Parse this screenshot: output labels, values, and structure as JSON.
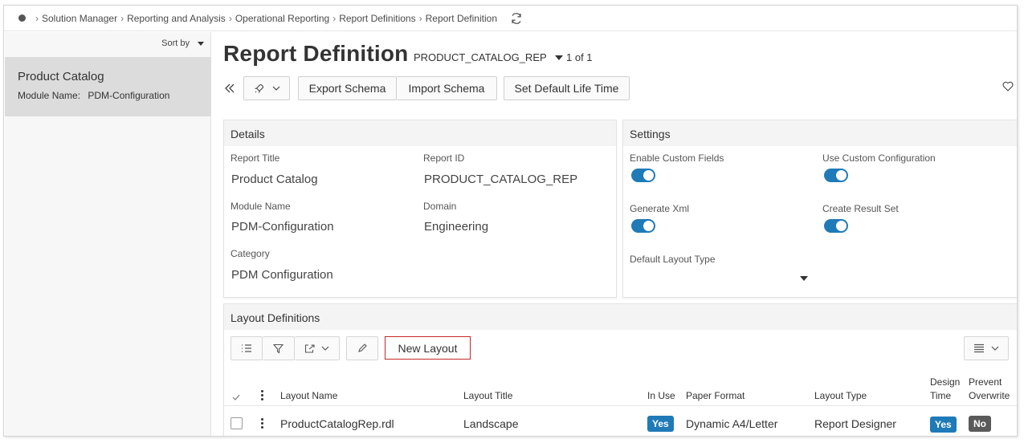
{
  "breadcrumb": {
    "items": [
      "Solution Manager",
      "Reporting and Analysis",
      "Operational Reporting",
      "Report Definitions",
      "Report Definition"
    ]
  },
  "list": {
    "sort_label": "Sort by",
    "selected": {
      "title": "Product Catalog",
      "meta_label": "Module Name:",
      "meta_value": "PDM-Configuration"
    }
  },
  "header": {
    "title": "Report Definition",
    "record_id": "PRODUCT_CATALOG_REP",
    "record_count": "1 of 1"
  },
  "toolbar": {
    "export_schema": "Export Schema",
    "import_schema": "Import Schema",
    "set_default_life_time": "Set Default Life Time"
  },
  "details": {
    "heading": "Details",
    "report_title_label": "Report Title",
    "report_title_value": "Product Catalog",
    "report_id_label": "Report ID",
    "report_id_value": "PRODUCT_CATALOG_REP",
    "module_name_label": "Module Name",
    "module_name_value": "PDM-Configuration",
    "domain_label": "Domain",
    "domain_value": "Engineering",
    "category_label": "Category",
    "category_value": "PDM Configuration"
  },
  "settings": {
    "heading": "Settings",
    "enable_custom_fields_label": "Enable Custom Fields",
    "enable_custom_fields": true,
    "use_custom_configuration_label": "Use Custom Configuration",
    "use_custom_configuration": true,
    "generate_xml_label": "Generate Xml",
    "generate_xml": true,
    "create_result_set_label": "Create Result Set",
    "create_result_set": true,
    "default_layout_type_label": "Default Layout Type",
    "default_layout_type_value": ""
  },
  "layouts": {
    "heading": "Layout Definitions",
    "new_layout_label": "New Layout",
    "columns": {
      "layout_name": "Layout Name",
      "layout_title": "Layout Title",
      "in_use": "In Use",
      "paper_format": "Paper Format",
      "layout_type": "Layout Type",
      "design_time_1": "Design",
      "design_time_2": "Time",
      "prevent_overwrite_1": "Prevent",
      "prevent_overwrite_2": "Overwrite"
    },
    "rows": [
      {
        "layout_name": "ProductCatalogRep.rdl",
        "layout_title": "Landscape",
        "in_use": "Yes",
        "paper_format": "Dynamic A4/Letter",
        "layout_type": "Report Designer",
        "design_time": "Yes",
        "prevent_overwrite": "No"
      }
    ]
  },
  "colors": {
    "accent": "#1f7ab8",
    "badge_yes": "#1f7ab8",
    "badge_no": "#5a5a5a",
    "highlight_border": "#c62828",
    "selected_row": "#dcdcdc"
  }
}
